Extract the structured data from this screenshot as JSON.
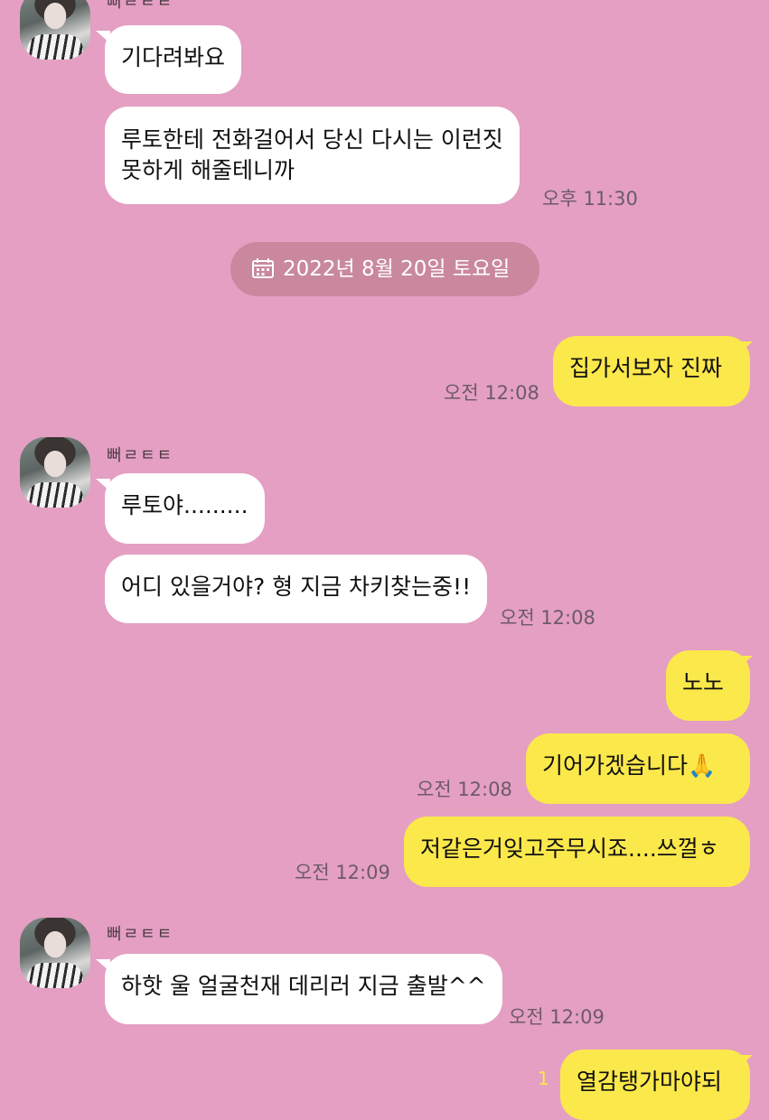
{
  "chat": {
    "msg1": {
      "sender": "뻐ㄹㅌㅌ",
      "bubble1": "기다려봐요",
      "bubble2_line1": "루토한테 전화걸어서 당신 다시는 이런짓",
      "bubble2_line2": "못하게 해줄테니까",
      "time": "오후 11:30"
    },
    "date_divider": "2022년 8월 20일 토요일",
    "out1": {
      "text": "집가서보자 진짜",
      "time": "오전 12:08"
    },
    "msg2": {
      "sender": "뻐ㄹㅌㅌ",
      "bubble1": "루토야.........",
      "bubble2": "어디 있을거야? 형 지금 차키찾는중!!",
      "time": "오전 12:08"
    },
    "out2": {
      "text1": "노노",
      "text2": "기어가겠습니다🙏",
      "time": "오전 12:08"
    },
    "out3": {
      "text": "저같은거잊고주무시죠....쓰껄ㅎ",
      "time": "오전 12:09"
    },
    "msg3": {
      "sender": "뻐ㄹㅌㅌ",
      "bubble1": "하핫 울 얼굴천재 데리러 지금 출발^^",
      "time": "오전 12:09"
    },
    "out4": {
      "text": "열감탱가마야되",
      "unread": "1"
    }
  },
  "icons": {
    "date": "calendar-icon"
  },
  "colors": {
    "background": "#e49fc3",
    "outgoing": "#fbe84b",
    "incoming": "#ffffff"
  }
}
